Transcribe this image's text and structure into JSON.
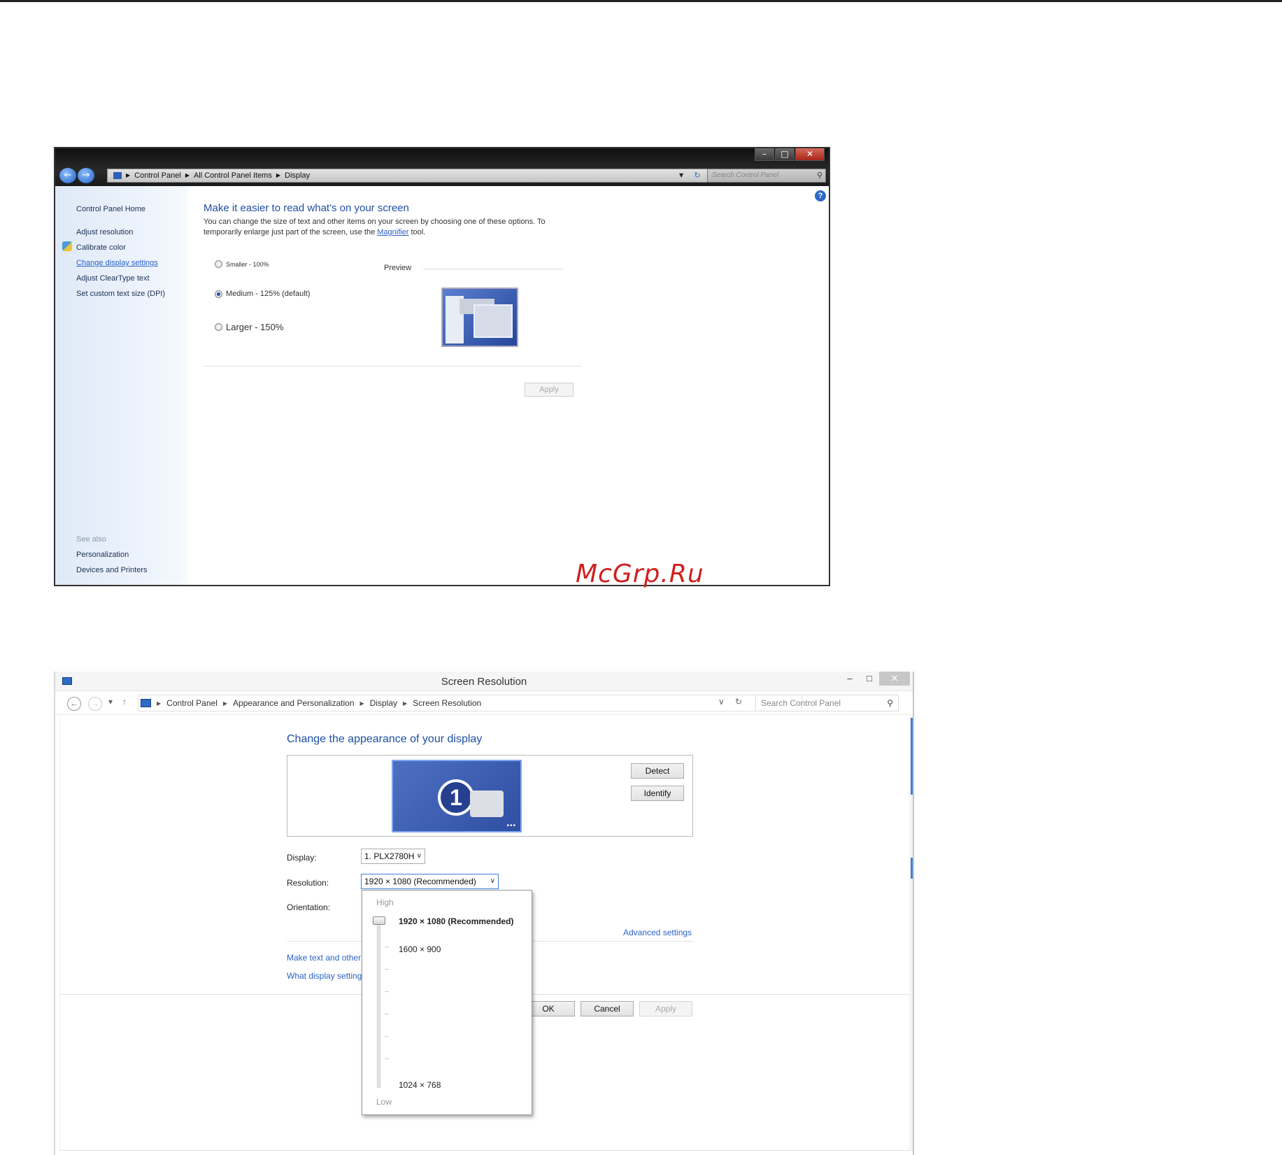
{
  "display_window": {
    "address": {
      "crumbs": [
        "Control Panel",
        "All Control Panel Items",
        "Display"
      ],
      "search_placeholder": "Search Control Panel"
    },
    "caption": {
      "minimize": "–",
      "maximize": "□",
      "close": "✕"
    },
    "sidebar": {
      "home": "Control Panel Home",
      "items": [
        "Adjust resolution",
        "Calibrate color",
        "Change display settings",
        "Adjust ClearType text",
        "Set custom text size (DPI)"
      ],
      "see_also_label": "See also",
      "see_also": [
        "Personalization",
        "Devices and Printers"
      ]
    },
    "main": {
      "heading": "Make it easier to read what's on your screen",
      "desc_part1": "You can change the size of text and other items on your screen by choosing one of these options. To temporarily enlarge just part of the screen, use the ",
      "desc_link": "Magnifier",
      "desc_part2": " tool.",
      "options": [
        {
          "label": "Smaller - 100%",
          "checked": false
        },
        {
          "label": "Medium - 125% (default)",
          "checked": true
        },
        {
          "label": "Larger - 150%",
          "checked": false
        }
      ],
      "preview_label": "Preview",
      "apply_label": "Apply",
      "help": "?"
    }
  },
  "watermark": "McGrp.Ru",
  "screen_resolution_window": {
    "title": "Screen Resolution",
    "caption": {
      "minimize": "–",
      "maximize": "□",
      "close": "✕"
    },
    "nav": {
      "back": "←",
      "forward": "→",
      "recent": "▾",
      "up": "↑",
      "crumbs": [
        "Control Panel",
        "Appearance and Personalization",
        "Display",
        "Screen Resolution"
      ],
      "dropdown": "∨",
      "refresh": "↻",
      "search_placeholder": "Search Control Panel"
    },
    "heading": "Change the appearance of your display",
    "monitor_number": "1",
    "detect_label": "Detect",
    "identify_label": "Identify",
    "display_label": "Display:",
    "display_value": "1. PLX2780H",
    "resolution_label": "Resolution:",
    "resolution_value": "1920 × 1080 (Recommended)",
    "orientation_label": "Orientation:",
    "advanced_settings": "Advanced settings",
    "link1": "Make text and other",
    "link2": "What display setting",
    "ok_label": "OK",
    "cancel_label": "Cancel",
    "apply_label": "Apply",
    "resolution_dropdown": {
      "high_label": "High",
      "low_label": "Low",
      "options": [
        "1920 × 1080 (Recommended)",
        "1600 × 900",
        "1024 × 768"
      ],
      "selected": "1920 × 1080 (Recommended)"
    }
  },
  "accent_colors": {
    "link_blue": "#2a63c7",
    "heading_blue": "#1f4fa4",
    "watermark_red": "#d02020"
  }
}
